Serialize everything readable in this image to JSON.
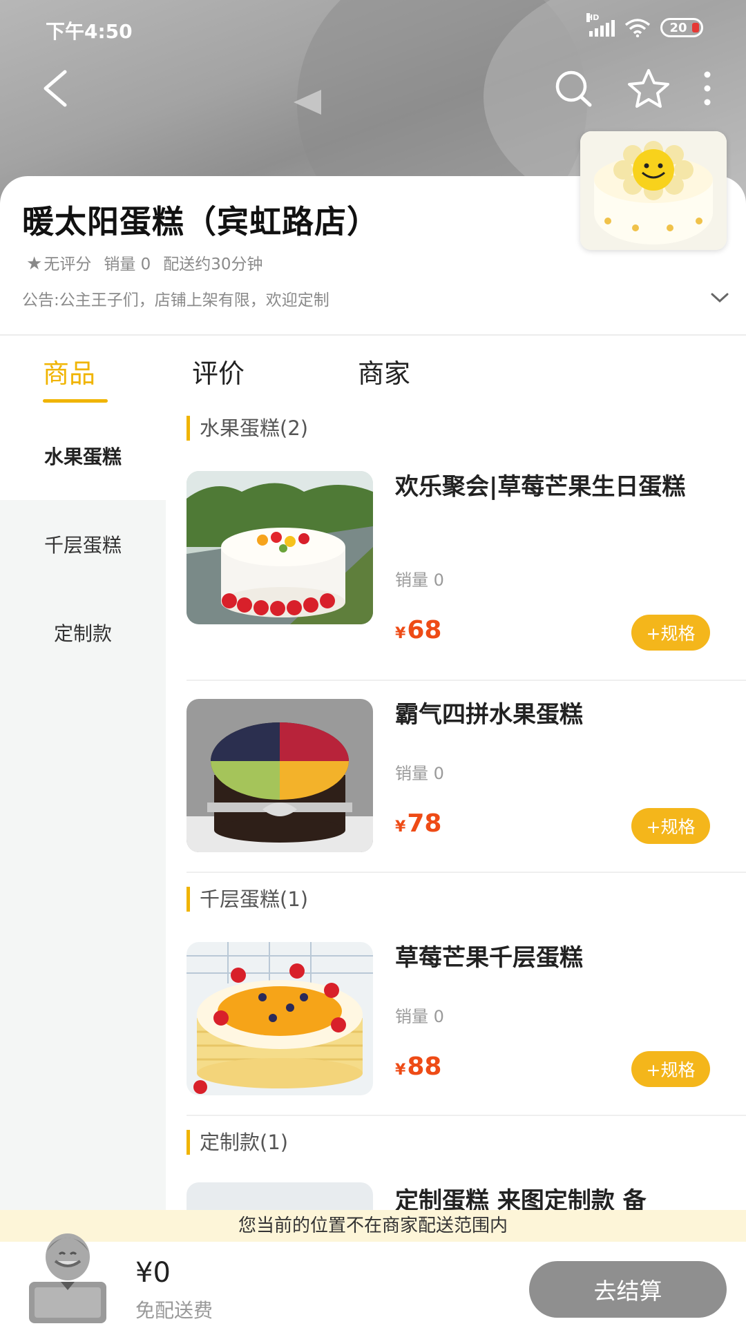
{
  "status_bar": {
    "time": "下午4:50",
    "network": "HD",
    "battery": "20"
  },
  "store": {
    "name": "暖太阳蛋糕（宾虹路店）",
    "rating": "无评分",
    "sales": "销量 0",
    "delivery": "配送约30分钟",
    "notice": "公告:公主王子们，店铺上架有限，欢迎定制"
  },
  "tabs": [
    {
      "label": "商品",
      "active": true
    },
    {
      "label": "评价",
      "active": false
    },
    {
      "label": "商家",
      "active": false
    }
  ],
  "categories": [
    {
      "label": "水果蛋糕",
      "active": true
    },
    {
      "label": "千层蛋糕",
      "active": false
    },
    {
      "label": "定制款",
      "active": false
    }
  ],
  "sections": [
    {
      "title": "水果蛋糕(2)"
    },
    {
      "title": "千层蛋糕(1)"
    },
    {
      "title": "定制款(1)"
    }
  ],
  "products": [
    {
      "name": "欢乐聚会|草莓芒果生日蛋糕",
      "sales": "销量 0",
      "currency": "¥",
      "price": "68",
      "spec_label": "+规格"
    },
    {
      "name": "霸气四拼水果蛋糕",
      "sales": "销量 0",
      "currency": "¥",
      "price": "78",
      "spec_label": "+规格"
    },
    {
      "name": "草莓芒果千层蛋糕",
      "sales": "销量 0",
      "currency": "¥",
      "price": "88",
      "spec_label": "+规格"
    },
    {
      "name": "定制蛋糕 来图定制款 备"
    }
  ],
  "bottom": {
    "warning": "您当前的位置不在商家配送范围内",
    "total": "¥0",
    "delivery_fee": "免配送费",
    "checkout_label": "去结算"
  },
  "colors": {
    "accent": "#f0b400",
    "price": "#ee4b16",
    "checkout": "#8f8f8f",
    "warn_bg": "#fdf5d8"
  }
}
